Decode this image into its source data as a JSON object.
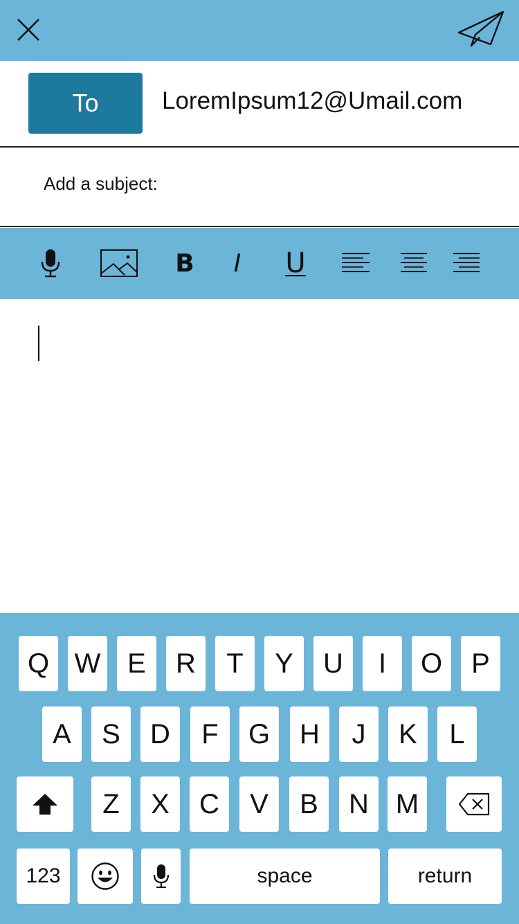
{
  "colors": {
    "header_blue": "#6bb5d8",
    "to_button_blue": "#1e799f",
    "key_white": "#ffffff"
  },
  "topbar": {
    "close_icon": "close-x-icon",
    "send_icon": "paper-plane-icon"
  },
  "recipient": {
    "to_label": "To",
    "value": "LoremIpsum12@Umail.com"
  },
  "subject": {
    "placeholder": "Add a subject:"
  },
  "toolbar": {
    "items": [
      {
        "name": "microphone",
        "icon": "microphone-icon"
      },
      {
        "name": "image",
        "icon": "image-icon"
      },
      {
        "name": "bold",
        "label": "B"
      },
      {
        "name": "italic",
        "label": "I"
      },
      {
        "name": "underline",
        "label": "U"
      },
      {
        "name": "align-left",
        "icon": "align-left-icon"
      },
      {
        "name": "align-center",
        "icon": "align-center-icon"
      },
      {
        "name": "align-right",
        "icon": "align-right-icon"
      }
    ]
  },
  "keyboard": {
    "row1": [
      "Q",
      "W",
      "E",
      "R",
      "T",
      "Y",
      "U",
      "I",
      "O",
      "P"
    ],
    "row2": [
      "A",
      "S",
      "D",
      "F",
      "G",
      "H",
      "J",
      "K",
      "L"
    ],
    "row3": [
      "Z",
      "X",
      "C",
      "V",
      "B",
      "N",
      "M"
    ],
    "shift_icon": "shift-arrow-icon",
    "delete_icon": "backspace-icon",
    "numbers_label": "123",
    "emoji_icon": "emoji-smiley-icon",
    "dictation_icon": "microphone-icon",
    "space_label": "space",
    "return_label": "return"
  }
}
